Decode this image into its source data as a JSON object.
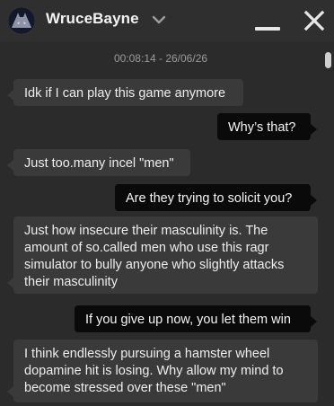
{
  "header": {
    "username": "WruceBayne",
    "avatar_icon": "batman-avatar",
    "dropdown_icon": "chevron-down-icon",
    "minimize_icon": "minimize-icon",
    "close_icon": "close-icon"
  },
  "chat": {
    "timestamp": "00:08:14 - 26/06/26",
    "messages": [
      {
        "direction": "incoming",
        "text": "Idk if I can play this game anymore"
      },
      {
        "direction": "outgoing",
        "text": "Why’s that?"
      },
      {
        "direction": "incoming",
        "text": "Just too.many incel \"men\""
      },
      {
        "direction": "outgoing",
        "text": "Are they trying to solicit you?"
      },
      {
        "direction": "incoming",
        "text": "Just how insecure their masculinity is. The amount of so.called men who use this ragr simulator to bully anyone who slightly attacks their masculinity"
      },
      {
        "direction": "outgoing",
        "text": "If you give up now, you let them win"
      },
      {
        "direction": "incoming",
        "text": "I think endlessly pursuing a hamster wheel dopamine hit is losing. Why allow my mind to become stressed over these \"men\""
      }
    ]
  },
  "colors": {
    "background": "#2b2b2b",
    "incoming_bubble": "#3a3a3a",
    "outgoing_bubble": "#0a0a0a",
    "timestamp_text": "#9a9a9a"
  }
}
